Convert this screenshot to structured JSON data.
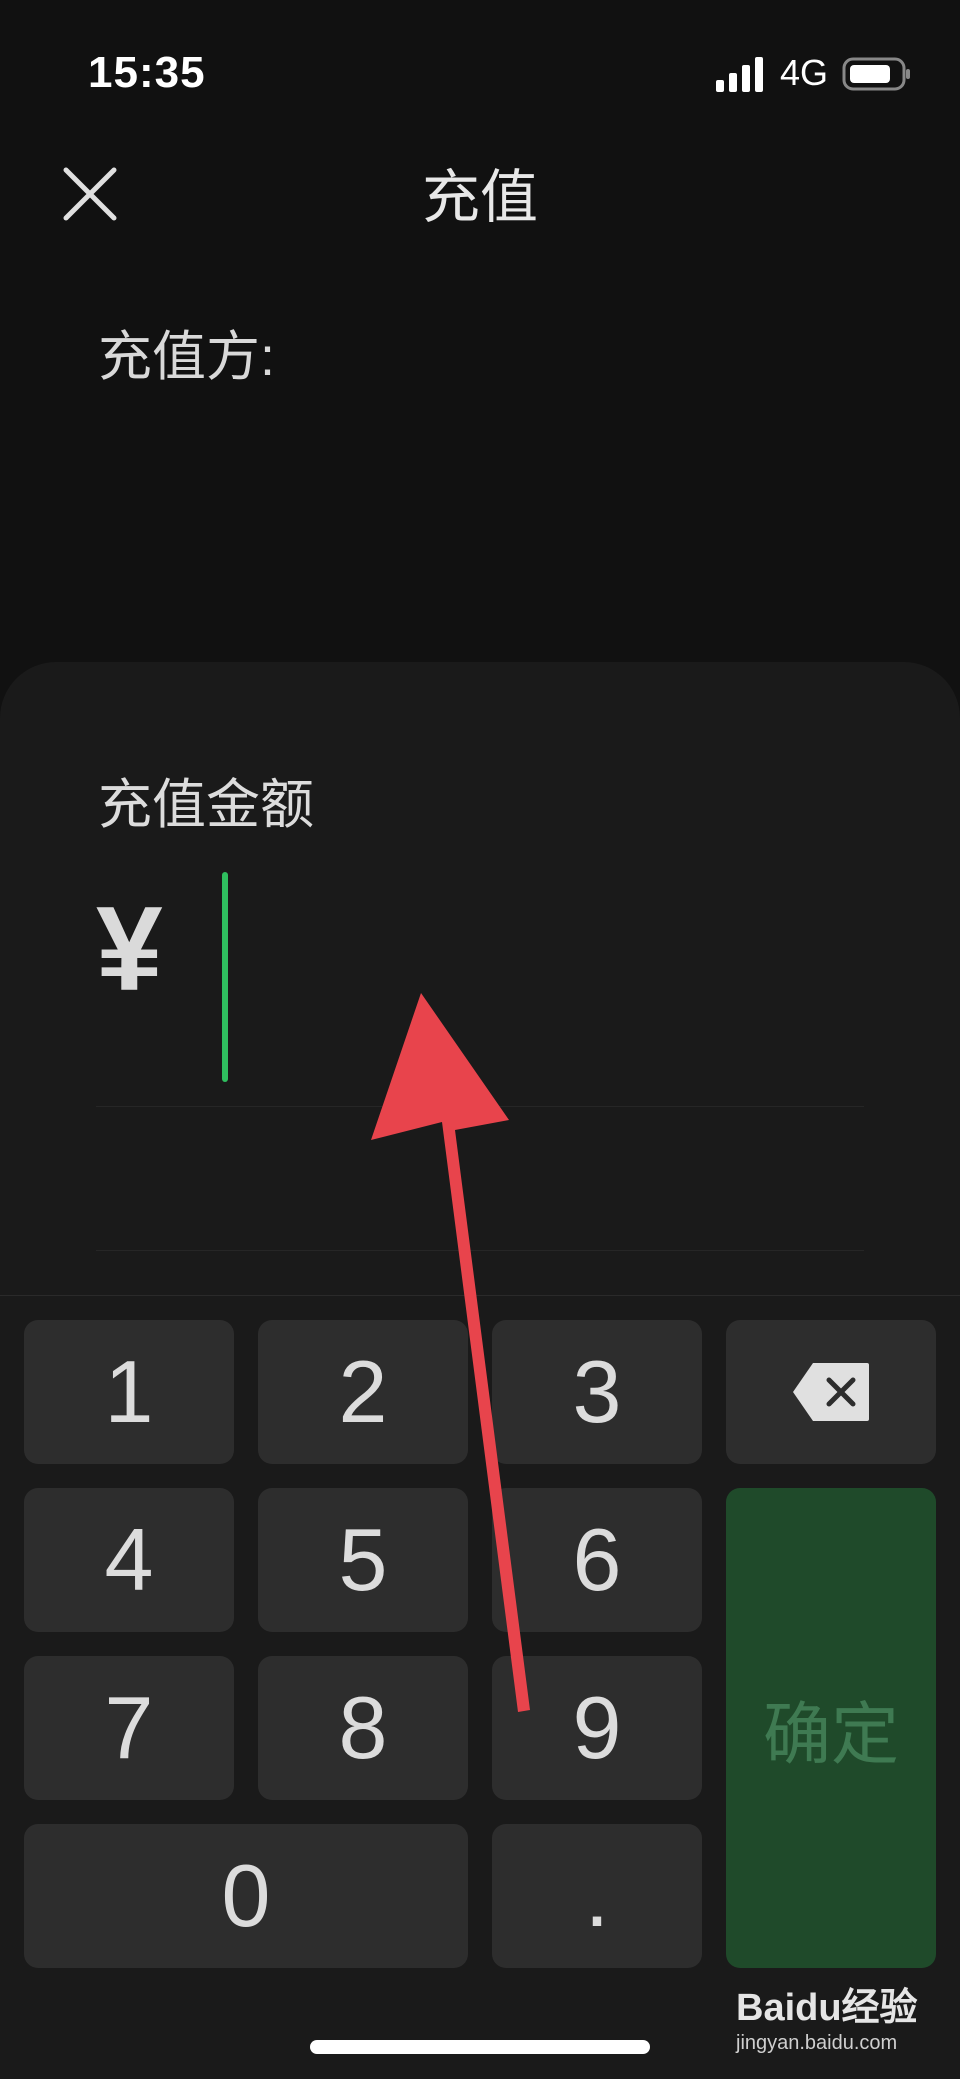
{
  "status_bar": {
    "time": "15:35",
    "network": "4G"
  },
  "header": {
    "title": "充值",
    "close_icon": "close-icon"
  },
  "method": {
    "label": "充值方:"
  },
  "amount": {
    "label": "充值金额",
    "currency": "¥",
    "value": ""
  },
  "keypad": {
    "keys": [
      "1",
      "2",
      "3",
      "4",
      "5",
      "6",
      "7",
      "8",
      "9",
      "0",
      "."
    ],
    "delete_icon": "backspace-icon",
    "confirm_label": "确定"
  },
  "watermark": {
    "brand": "Baidu经验",
    "url": "jingyan.baidu.com"
  },
  "colors": {
    "background": "#111111",
    "panel": "#1a1a1a",
    "key": "#2d2d2d",
    "confirm": "#1f4a2a",
    "cursor": "#2fbf5f",
    "arrow": "#e8444c"
  }
}
